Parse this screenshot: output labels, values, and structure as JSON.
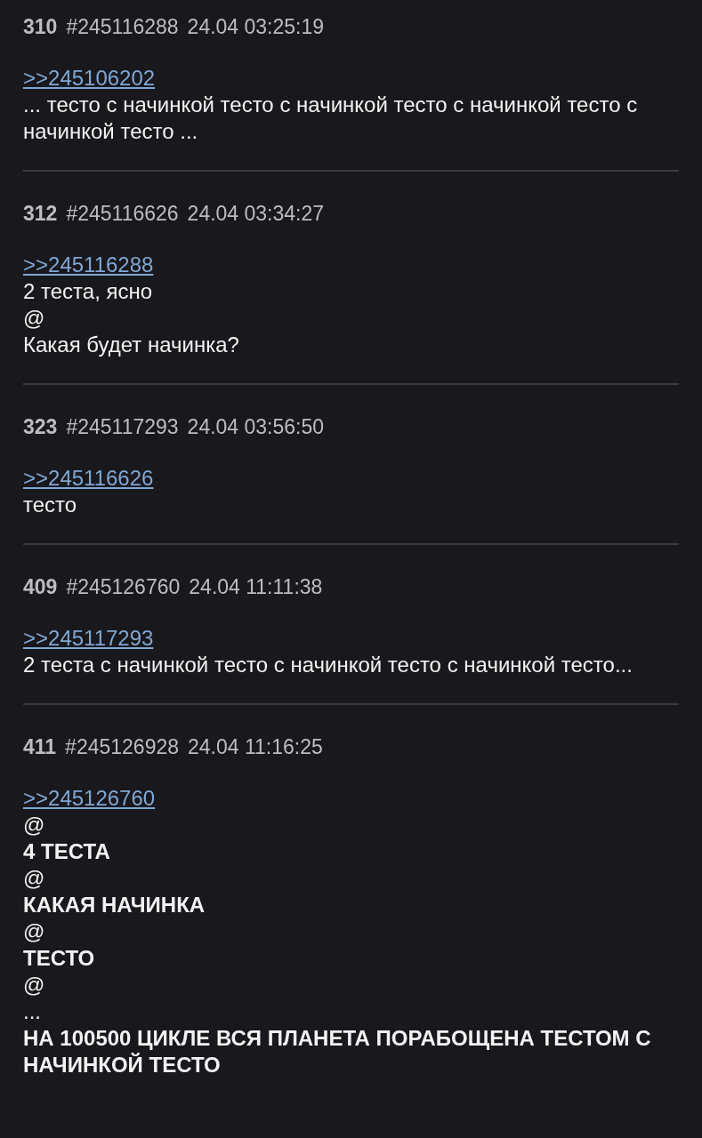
{
  "posts": [
    {
      "number": "310",
      "id": "#245116288",
      "date": "24.04 03:25:19",
      "reply_link": ">>245106202",
      "lines": [
        {
          "text": "... тесто с начинкой тесто с начинкой тесто с начинкой тесто с начинкой тесто ...",
          "bold": false
        }
      ]
    },
    {
      "number": "312",
      "id": "#245116626",
      "date": "24.04 03:34:27",
      "reply_link": ">>245116288",
      "lines": [
        {
          "text": "2 теста, ясно",
          "bold": false
        },
        {
          "text": "@",
          "bold": false
        },
        {
          "text": "Какая будет начинка?",
          "bold": false
        }
      ]
    },
    {
      "number": "323",
      "id": "#245117293",
      "date": "24.04 03:56:50",
      "reply_link": ">>245116626",
      "lines": [
        {
          "text": "тесто",
          "bold": false
        }
      ]
    },
    {
      "number": "409",
      "id": "#245126760",
      "date": "24.04 11:11:38",
      "reply_link": ">>245117293",
      "lines": [
        {
          "text": "2 теста с начинкой тесто с начинкой тесто с начинкой тесто...",
          "bold": false
        }
      ]
    },
    {
      "number": "411",
      "id": "#245126928",
      "date": "24.04 11:16:25",
      "reply_link": ">>245126760",
      "lines": [
        {
          "text": "@",
          "bold": false
        },
        {
          "text": "4 ТЕСТА",
          "bold": true
        },
        {
          "text": "@",
          "bold": false
        },
        {
          "text": "КАКАЯ НАЧИНКА",
          "bold": true
        },
        {
          "text": "@",
          "bold": false
        },
        {
          "text": "ТЕСТО",
          "bold": true
        },
        {
          "text": "@",
          "bold": false
        },
        {
          "text": "...",
          "bold": false
        },
        {
          "text": "НА 100500 ЦИКЛЕ ВСЯ ПЛАНЕТА ПОРАБОЩЕНА ТЕСТОМ С НАЧИНКОЙ ТЕСТО",
          "bold": true
        }
      ]
    }
  ]
}
